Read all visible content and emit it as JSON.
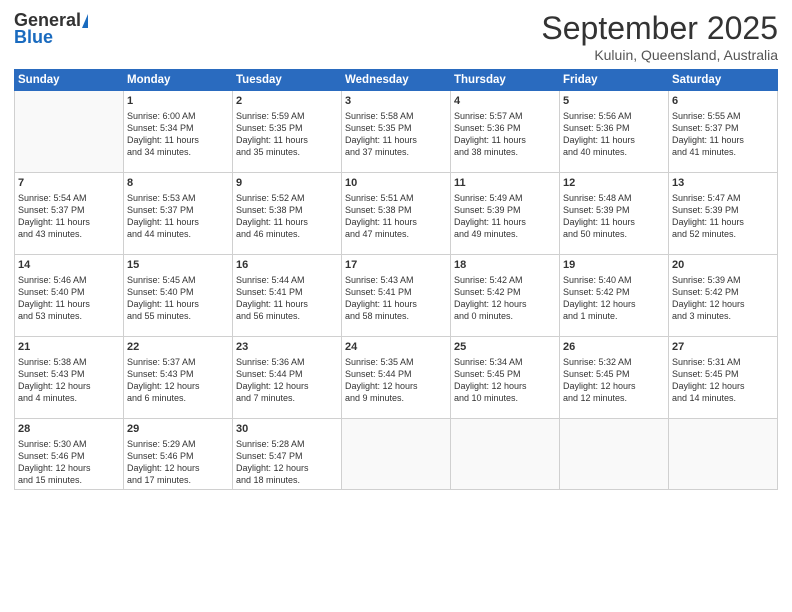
{
  "logo": {
    "general": "General",
    "blue": "Blue"
  },
  "header": {
    "month": "September 2025",
    "location": "Kuluin, Queensland, Australia"
  },
  "weekdays": [
    "Sunday",
    "Monday",
    "Tuesday",
    "Wednesday",
    "Thursday",
    "Friday",
    "Saturday"
  ],
  "weeks": [
    [
      {
        "day": "",
        "content": ""
      },
      {
        "day": "1",
        "content": "Sunrise: 6:00 AM\nSunset: 5:34 PM\nDaylight: 11 hours\nand 34 minutes."
      },
      {
        "day": "2",
        "content": "Sunrise: 5:59 AM\nSunset: 5:35 PM\nDaylight: 11 hours\nand 35 minutes."
      },
      {
        "day": "3",
        "content": "Sunrise: 5:58 AM\nSunset: 5:35 PM\nDaylight: 11 hours\nand 37 minutes."
      },
      {
        "day": "4",
        "content": "Sunrise: 5:57 AM\nSunset: 5:36 PM\nDaylight: 11 hours\nand 38 minutes."
      },
      {
        "day": "5",
        "content": "Sunrise: 5:56 AM\nSunset: 5:36 PM\nDaylight: 11 hours\nand 40 minutes."
      },
      {
        "day": "6",
        "content": "Sunrise: 5:55 AM\nSunset: 5:37 PM\nDaylight: 11 hours\nand 41 minutes."
      }
    ],
    [
      {
        "day": "7",
        "content": "Sunrise: 5:54 AM\nSunset: 5:37 PM\nDaylight: 11 hours\nand 43 minutes."
      },
      {
        "day": "8",
        "content": "Sunrise: 5:53 AM\nSunset: 5:37 PM\nDaylight: 11 hours\nand 44 minutes."
      },
      {
        "day": "9",
        "content": "Sunrise: 5:52 AM\nSunset: 5:38 PM\nDaylight: 11 hours\nand 46 minutes."
      },
      {
        "day": "10",
        "content": "Sunrise: 5:51 AM\nSunset: 5:38 PM\nDaylight: 11 hours\nand 47 minutes."
      },
      {
        "day": "11",
        "content": "Sunrise: 5:49 AM\nSunset: 5:39 PM\nDaylight: 11 hours\nand 49 minutes."
      },
      {
        "day": "12",
        "content": "Sunrise: 5:48 AM\nSunset: 5:39 PM\nDaylight: 11 hours\nand 50 minutes."
      },
      {
        "day": "13",
        "content": "Sunrise: 5:47 AM\nSunset: 5:39 PM\nDaylight: 11 hours\nand 52 minutes."
      }
    ],
    [
      {
        "day": "14",
        "content": "Sunrise: 5:46 AM\nSunset: 5:40 PM\nDaylight: 11 hours\nand 53 minutes."
      },
      {
        "day": "15",
        "content": "Sunrise: 5:45 AM\nSunset: 5:40 PM\nDaylight: 11 hours\nand 55 minutes."
      },
      {
        "day": "16",
        "content": "Sunrise: 5:44 AM\nSunset: 5:41 PM\nDaylight: 11 hours\nand 56 minutes."
      },
      {
        "day": "17",
        "content": "Sunrise: 5:43 AM\nSunset: 5:41 PM\nDaylight: 11 hours\nand 58 minutes."
      },
      {
        "day": "18",
        "content": "Sunrise: 5:42 AM\nSunset: 5:42 PM\nDaylight: 12 hours\nand 0 minutes."
      },
      {
        "day": "19",
        "content": "Sunrise: 5:40 AM\nSunset: 5:42 PM\nDaylight: 12 hours\nand 1 minute."
      },
      {
        "day": "20",
        "content": "Sunrise: 5:39 AM\nSunset: 5:42 PM\nDaylight: 12 hours\nand 3 minutes."
      }
    ],
    [
      {
        "day": "21",
        "content": "Sunrise: 5:38 AM\nSunset: 5:43 PM\nDaylight: 12 hours\nand 4 minutes."
      },
      {
        "day": "22",
        "content": "Sunrise: 5:37 AM\nSunset: 5:43 PM\nDaylight: 12 hours\nand 6 minutes."
      },
      {
        "day": "23",
        "content": "Sunrise: 5:36 AM\nSunset: 5:44 PM\nDaylight: 12 hours\nand 7 minutes."
      },
      {
        "day": "24",
        "content": "Sunrise: 5:35 AM\nSunset: 5:44 PM\nDaylight: 12 hours\nand 9 minutes."
      },
      {
        "day": "25",
        "content": "Sunrise: 5:34 AM\nSunset: 5:45 PM\nDaylight: 12 hours\nand 10 minutes."
      },
      {
        "day": "26",
        "content": "Sunrise: 5:32 AM\nSunset: 5:45 PM\nDaylight: 12 hours\nand 12 minutes."
      },
      {
        "day": "27",
        "content": "Sunrise: 5:31 AM\nSunset: 5:45 PM\nDaylight: 12 hours\nand 14 minutes."
      }
    ],
    [
      {
        "day": "28",
        "content": "Sunrise: 5:30 AM\nSunset: 5:46 PM\nDaylight: 12 hours\nand 15 minutes."
      },
      {
        "day": "29",
        "content": "Sunrise: 5:29 AM\nSunset: 5:46 PM\nDaylight: 12 hours\nand 17 minutes."
      },
      {
        "day": "30",
        "content": "Sunrise: 5:28 AM\nSunset: 5:47 PM\nDaylight: 12 hours\nand 18 minutes."
      },
      {
        "day": "",
        "content": ""
      },
      {
        "day": "",
        "content": ""
      },
      {
        "day": "",
        "content": ""
      },
      {
        "day": "",
        "content": ""
      }
    ]
  ]
}
